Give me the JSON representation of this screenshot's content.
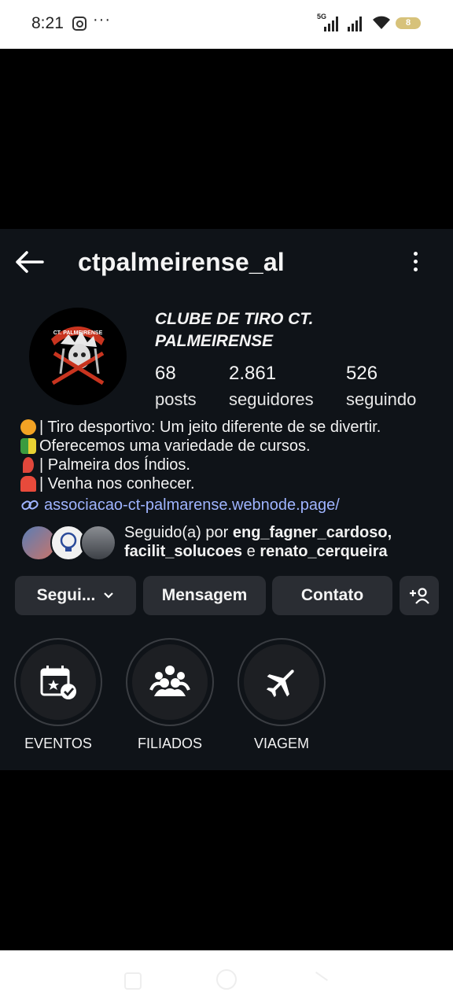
{
  "status_bar": {
    "time": "8:21",
    "dots": "···",
    "network": "5G",
    "battery": "8"
  },
  "header": {
    "username": "ctpalmeirense_al"
  },
  "profile": {
    "full_name_line1": "CLUBE DE TIRO CT.",
    "full_name_line2": "PALMEIRENSE",
    "avatar_text": "CT. PALMEIRENSE",
    "stats": [
      {
        "value": "68",
        "label": "posts"
      },
      {
        "value": "2.861",
        "label": "seguidores"
      },
      {
        "value": "526",
        "label": "seguindo"
      }
    ]
  },
  "bio": {
    "lines": [
      {
        "text": "| Tiro desportivo: Um jeito diferente de se divertir.",
        "emoji_color": "#f3a324"
      },
      {
        "text": "Oferecemos uma variedade de cursos.",
        "emoji_color": "#3b9b3f"
      },
      {
        "text": "| Palmeira dos Índios.",
        "emoji_color": "#e0473b"
      },
      {
        "text": "| Venha nos conhecer.",
        "emoji_color": "#e84a3b"
      }
    ],
    "link": "associacao-ct-palmarense.webnode.page/"
  },
  "followed_by": {
    "prefix": "Seguido(a) por ",
    "user1": "eng_fagner_cardoso,",
    "user2": "facilit_solucoes",
    "conj": " e ",
    "user3": "renato_cerqueira"
  },
  "buttons": {
    "following": "Segui...",
    "message": "Mensagem",
    "contact": "Contato"
  },
  "highlights": [
    {
      "label": "EVENTOS",
      "icon": "calendar-star-icon"
    },
    {
      "label": "FILIADOS",
      "icon": "group-icon"
    },
    {
      "label": "VIAGEM",
      "icon": "airplane-icon"
    }
  ],
  "colors": {
    "background": "#0f1318",
    "button_bg": "#2a2d33",
    "link": "#9fb4ff"
  }
}
